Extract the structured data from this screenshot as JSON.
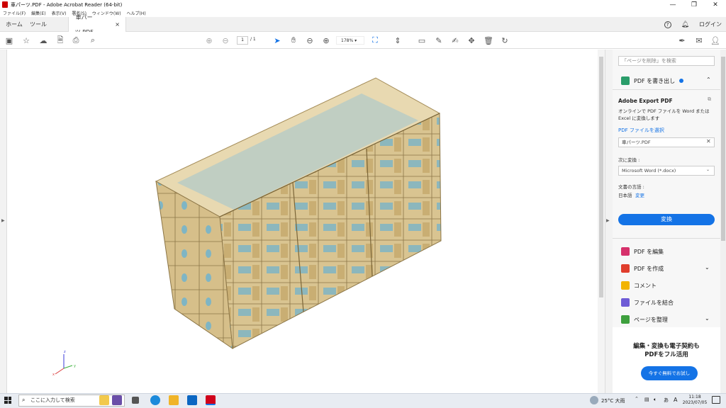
{
  "window": {
    "title": "車パーツ.PDF - Adobe Acrobat Reader (64-bit)",
    "minimize": "—",
    "maximize": "❐",
    "close": "✕"
  },
  "menu": [
    "ファイル(F)",
    "編集(E)",
    "表示(V)",
    "署名(S)",
    "ウィンドウ(W)",
    "ヘルプ(H)"
  ],
  "tabs": {
    "home": "ホーム",
    "tools": "ツール",
    "document": "車パーツ.PDF",
    "close": "×",
    "signin": "ログイン"
  },
  "toolbar": {
    "page_current": "1",
    "page_total": "/ 1",
    "zoom": "178%"
  },
  "axes": {
    "x": "x",
    "y": "y",
    "z": "z"
  },
  "panel": {
    "search_placeholder": "「ページを削除」を検索",
    "export_header": "PDF を書き出し",
    "export_title": "Adobe Export PDF",
    "export_desc": "オンラインで PDF ファイルを Word または Excel に変換します",
    "select_file": "PDF ファイルを選択",
    "file_name": "車パーツ.PDF",
    "convert_to_label": "次に変換 :",
    "convert_to_value": "Microsoft Word (*.docx)",
    "doc_lang_label": "文書の言語 :",
    "doc_lang_value": "日本語",
    "doc_lang_change": "変更",
    "convert_button": "変換",
    "tools": [
      {
        "label": "PDF を編集",
        "color": "#d6316b"
      },
      {
        "label": "PDF を作成",
        "color": "#e03e2d"
      },
      {
        "label": "コメント",
        "color": "#f2b400"
      },
      {
        "label": "ファイルを結合",
        "color": "#6e5bd6"
      },
      {
        "label": "ページを整理",
        "color": "#3ea03e"
      }
    ],
    "promo_line1": "編集・変換も電子契約も",
    "promo_line2": "PDFをフル活用",
    "promo_button": "今すぐ無料でお試し"
  },
  "taskbar": {
    "search_placeholder": "ここに入力して検索",
    "weather": "25°C 大雨",
    "ime": "A",
    "time": "11:18",
    "date": "2023/07/05"
  }
}
